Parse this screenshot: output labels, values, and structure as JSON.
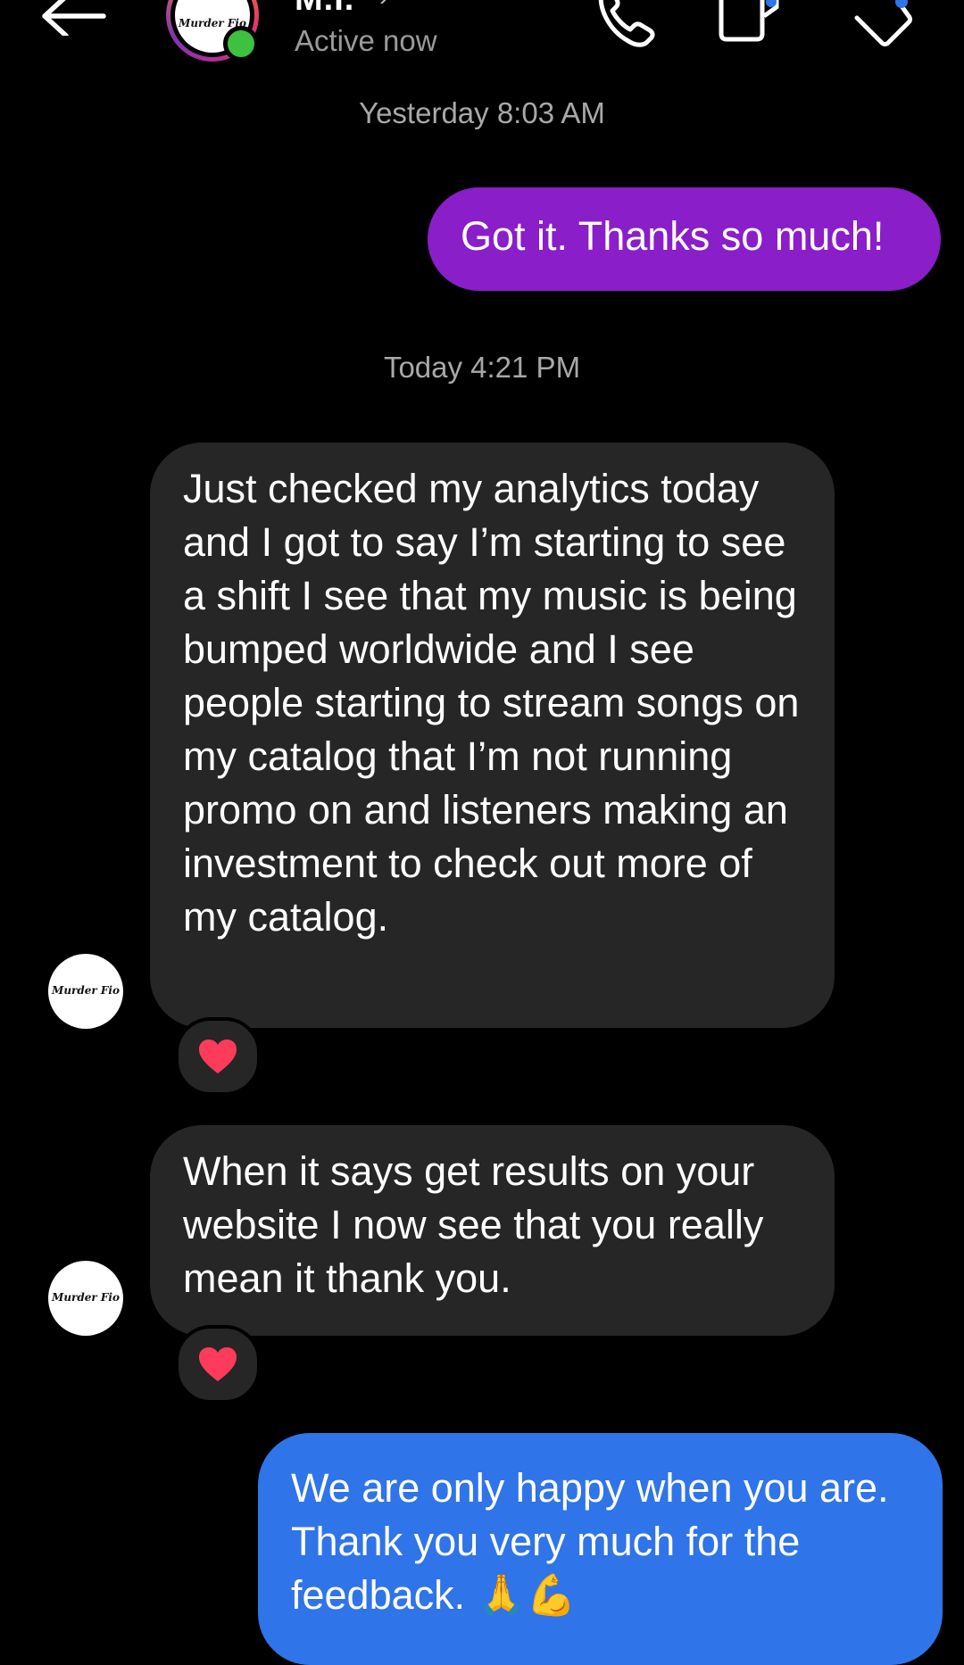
{
  "header": {
    "contact_name": "M.I.",
    "chevron": "›",
    "status": "Active now",
    "avatar_logo_text": "Murder Fio",
    "icons": [
      "back-arrow-icon",
      "phone-icon",
      "video-camera-icon",
      "tag-icon"
    ]
  },
  "thread": {
    "timestamp_1": "Yesterday 8:03 AM",
    "message_1": "Got it. Thanks so much!",
    "timestamp_2": "Today 4:21 PM",
    "message_2": "Just checked my analytics today and I got to say I’m starting to see a shift I see that my music is being bumped worldwide and I see people starting to stream songs on my catalog that I’m not running promo on and listeners making an investment to check out more of my catalog.",
    "message_2_reaction": "❤️",
    "message_3": "When it says get results on your website I now see that you really mean it thank you.",
    "message_3_reaction": "❤️",
    "message_4": "We are only happy when you are. Thank you very much for the feedback. 🙏💪",
    "sender_avatar_text": "Murder Fio"
  },
  "colors": {
    "background": "#000000",
    "outgoing_purple": "#8a1ec8",
    "incoming_gray": "#262626",
    "outgoing_blue": "#2f74e8",
    "online_green": "#3ec13e",
    "reaction_heart": "#ff3b5c"
  }
}
